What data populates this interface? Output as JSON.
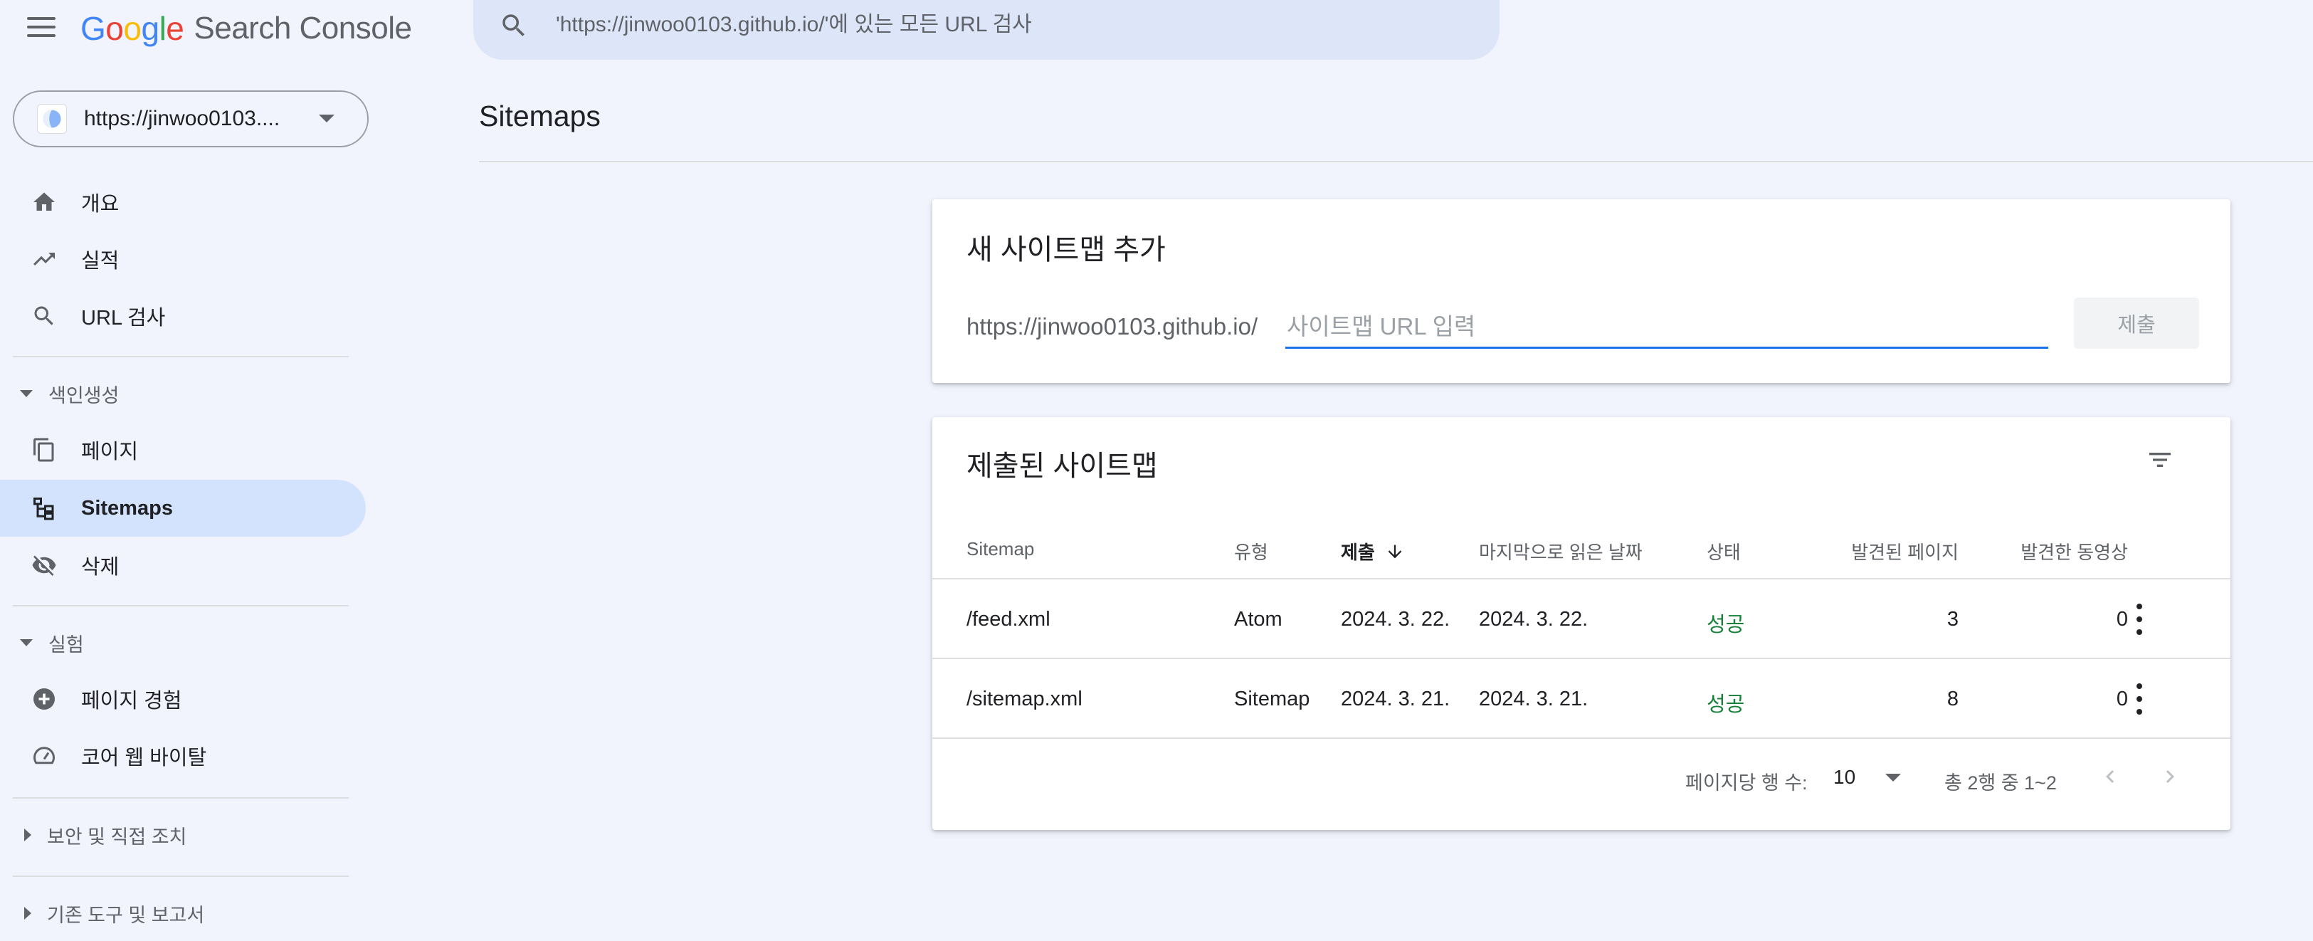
{
  "header": {
    "logo_letters": [
      "G",
      "o",
      "o",
      "g",
      "l",
      "e"
    ],
    "product": "Search Console",
    "search_placeholder": "'https://jinwoo0103.github.io/'에 있는 모든 URL 검사"
  },
  "sidebar": {
    "property": "https://jinwoo0103....",
    "items": {
      "overview": "개요",
      "performance": "실적",
      "url_inspection": "URL 검사",
      "pages": "페이지",
      "sitemaps": "Sitemaps",
      "removals": "삭제",
      "page_experience": "페이지 경험",
      "core_web_vitals": "코어 웹 바이탈"
    },
    "sections": {
      "indexing": "색인생성",
      "experience": "실험",
      "security": "보안 및 직접 조치",
      "legacy": "기존 도구 및 보고서"
    }
  },
  "main": {
    "title": "Sitemaps",
    "add_card": {
      "title": "새 사이트맵 추가",
      "prefix": "https://jinwoo0103.github.io/",
      "input_placeholder": "사이트맵 URL 입력",
      "submit_label": "제출"
    },
    "list_card": {
      "title": "제출된 사이트맵",
      "columns": {
        "sitemap": "Sitemap",
        "type": "유형",
        "submitted": "제출",
        "last_read": "마지막으로 읽은 날짜",
        "status": "상태",
        "pages_found": "발견된 페이지",
        "videos_found": "발견한 동영상"
      },
      "rows": [
        {
          "sitemap": "/feed.xml",
          "type": "Atom",
          "submitted": "2024. 3. 22.",
          "last_read": "2024. 3. 22.",
          "status": "성공",
          "pages": "3",
          "videos": "0"
        },
        {
          "sitemap": "/sitemap.xml",
          "type": "Sitemap",
          "submitted": "2024. 3. 21.",
          "last_read": "2024. 3. 21.",
          "status": "성공",
          "pages": "8",
          "videos": "0"
        }
      ],
      "pager": {
        "rows_per_page_label": "페이지당 행 수:",
        "rows_per_page": "10",
        "range": "총 2행 중 1~2"
      }
    }
  },
  "colors": {
    "background": "#f1f4fc",
    "active_nav": "#d3e3fd",
    "accent": "#1a73e8",
    "success": "#188038"
  }
}
